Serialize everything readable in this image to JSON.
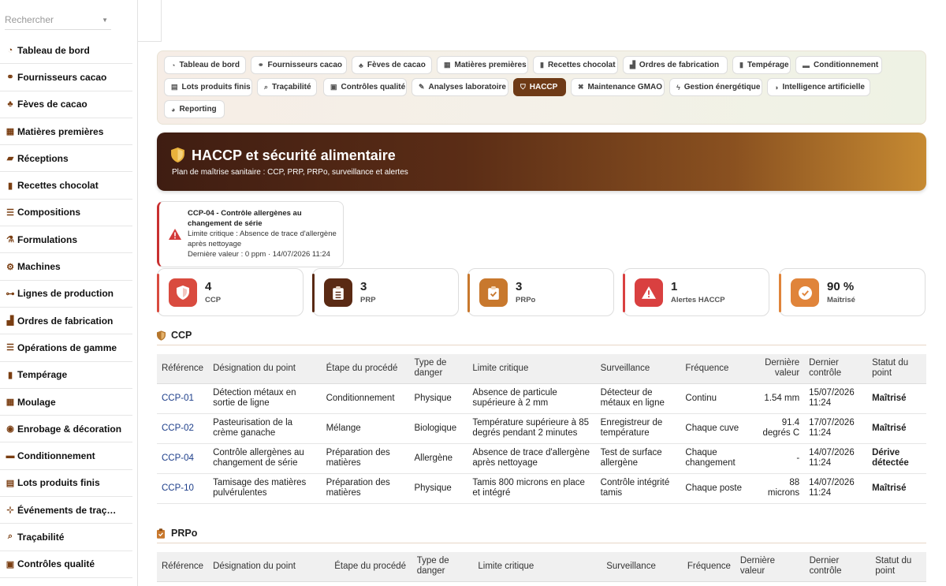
{
  "search": {
    "placeholder": "Rechercher"
  },
  "sidebar": {
    "items": [
      {
        "label": "Tableau de bord",
        "icon": "gauge-icon"
      },
      {
        "label": "Fournisseurs cacao",
        "icon": "handshake-icon"
      },
      {
        "label": "Fèves de cacao",
        "icon": "seedling-icon"
      },
      {
        "label": "Matières premières",
        "icon": "cubes-icon"
      },
      {
        "label": "Réceptions",
        "icon": "truck-icon"
      },
      {
        "label": "Recettes chocolat",
        "icon": "book-icon"
      },
      {
        "label": "Compositions",
        "icon": "list-icon"
      },
      {
        "label": "Formulations",
        "icon": "flask-icon"
      },
      {
        "label": "Machines",
        "icon": "gears-icon"
      },
      {
        "label": "Lignes de production",
        "icon": "sitemap-icon"
      },
      {
        "label": "Ordres de fabrication",
        "icon": "industry-icon"
      },
      {
        "label": "Opérations de gamme",
        "icon": "list-icon"
      },
      {
        "label": "Tempérage",
        "icon": "thermometer-icon"
      },
      {
        "label": "Moulage",
        "icon": "grid-icon"
      },
      {
        "label": "Enrobage & décoration",
        "icon": "cookie-icon"
      },
      {
        "label": "Conditionnement",
        "icon": "box-icon"
      },
      {
        "label": "Lots produits finis",
        "icon": "pallet-icon"
      },
      {
        "label": "Événements de traç…",
        "icon": "network-icon"
      },
      {
        "label": "Traçabilité",
        "icon": "search-icon"
      },
      {
        "label": "Contrôles qualité",
        "icon": "clipboard-icon"
      }
    ]
  },
  "tabs": [
    {
      "label": "Tableau de bord",
      "icon": "gauge-icon",
      "active": false
    },
    {
      "label": "Fournisseurs cacao",
      "icon": "handshake-icon",
      "active": false
    },
    {
      "label": "Fèves de cacao",
      "icon": "seedling-icon",
      "active": false
    },
    {
      "label": "Matières premières",
      "icon": "cubes-icon",
      "active": false
    },
    {
      "label": "Recettes chocolat",
      "icon": "book-icon",
      "active": false
    },
    {
      "label": "Ordres de fabrication",
      "icon": "industry-icon",
      "active": false
    },
    {
      "label": "Tempérage",
      "icon": "thermometer-icon",
      "active": false
    },
    {
      "label": "Conditionnement",
      "icon": "box-icon",
      "active": false
    },
    {
      "label": "Lots produits finis",
      "icon": "pallet-icon",
      "active": false
    },
    {
      "label": "Traçabilité",
      "icon": "search-icon",
      "active": false
    },
    {
      "label": "Contrôles qualité",
      "icon": "clipboard-icon",
      "active": false
    },
    {
      "label": "Analyses laboratoire",
      "icon": "microscope-icon",
      "active": false
    },
    {
      "label": "HACCP",
      "icon": "shield-icon",
      "active": true
    },
    {
      "label": "Maintenance GMAO",
      "icon": "tools-icon",
      "active": false
    },
    {
      "label": "Gestion énergétique",
      "icon": "bolt-icon",
      "active": false
    },
    {
      "label": "Intelligence artificielle",
      "icon": "brain-icon",
      "active": false
    },
    {
      "label": "Reporting",
      "icon": "chart-pie-icon",
      "active": false
    }
  ],
  "hero": {
    "title": "HACCP et sécurité alimentaire",
    "subtitle": "Plan de maîtrise sanitaire : CCP, PRP, PRPo, surveillance et alertes"
  },
  "alert": {
    "title": "CCP-04 - Contrôle allergènes au changement de série",
    "limit": "Limite critique : Absence de trace d'allergène après nettoyage",
    "last_value": "Dernière valeur : 0 ppm · 14/07/2026 11:24"
  },
  "kpis": [
    {
      "value": "4",
      "label": "CCP",
      "icon": "shield-icon",
      "color": "#d94b3f"
    },
    {
      "value": "3",
      "label": "PRP",
      "icon": "clipboard-list-icon",
      "color": "#5a2a14"
    },
    {
      "value": "3",
      "label": "PRPo",
      "icon": "clipboard-check-icon",
      "color": "#c8782d"
    },
    {
      "value": "1",
      "label": "Alertes HACCP",
      "icon": "warning-icon",
      "color": "#d94040"
    },
    {
      "value": "90 %",
      "label": "Maîtrisé",
      "icon": "check-circle-icon",
      "color": "#e0843a"
    }
  ],
  "ccp_section": {
    "title": "CCP",
    "headers": [
      "Référence",
      "Désignation du point",
      "Étape du procédé",
      "Type de danger",
      "Limite critique",
      "Surveillance",
      "Fréquence",
      "Dernière valeur",
      "Dernier contrôle",
      "Statut du point"
    ],
    "rows": [
      {
        "ref": "CCP-01",
        "designation": "Détection métaux en sortie de ligne",
        "etape": "Conditionnement",
        "danger": "Physique",
        "limite": "Absence de particule supérieure à 2 mm",
        "surveillance": "Détecteur de métaux en ligne",
        "frequence": "Continu",
        "valeur": "1.54 mm",
        "controle": "15/07/2026 11:24",
        "statut": "Maîtrisé",
        "status_kind": "ok"
      },
      {
        "ref": "CCP-02",
        "designation": "Pasteurisation de la crème ganache",
        "etape": "Mélange",
        "danger": "Biologique",
        "limite": "Température supérieure à 85 degrés pendant 2 minutes",
        "surveillance": "Enregistreur de température",
        "frequence": "Chaque cuve",
        "valeur": "91.4 degrés C",
        "controle": "17/07/2026 11:24",
        "statut": "Maîtrisé",
        "status_kind": "ok"
      },
      {
        "ref": "CCP-04",
        "designation": "Contrôle allergènes au changement de série",
        "etape": "Préparation des matières",
        "danger": "Allergène",
        "limite": "Absence de trace d'allergène après nettoyage",
        "surveillance": "Test de surface allergène",
        "frequence": "Chaque changement",
        "valeur": "-",
        "controle": "14/07/2026 11:24",
        "statut": "Dérive détectée",
        "status_kind": "bad"
      },
      {
        "ref": "CCP-10",
        "designation": "Tamisage des matières pulvérulentes",
        "etape": "Préparation des matières",
        "danger": "Physique",
        "limite": "Tamis 800 microns en place et intégré",
        "surveillance": "Contrôle intégrité tamis",
        "frequence": "Chaque poste",
        "valeur": "88 microns",
        "controle": "14/07/2026 11:24",
        "statut": "Maîtrisé",
        "status_kind": "ok"
      }
    ]
  },
  "prpo_section": {
    "title": "PRPo",
    "headers": [
      "Référence",
      "Désignation du point",
      "Étape du procédé",
      "Type de danger",
      "Limite critique",
      "Surveillance",
      "Fréquence",
      "Dernière valeur",
      "Dernier contrôle",
      "Statut du point"
    ]
  }
}
